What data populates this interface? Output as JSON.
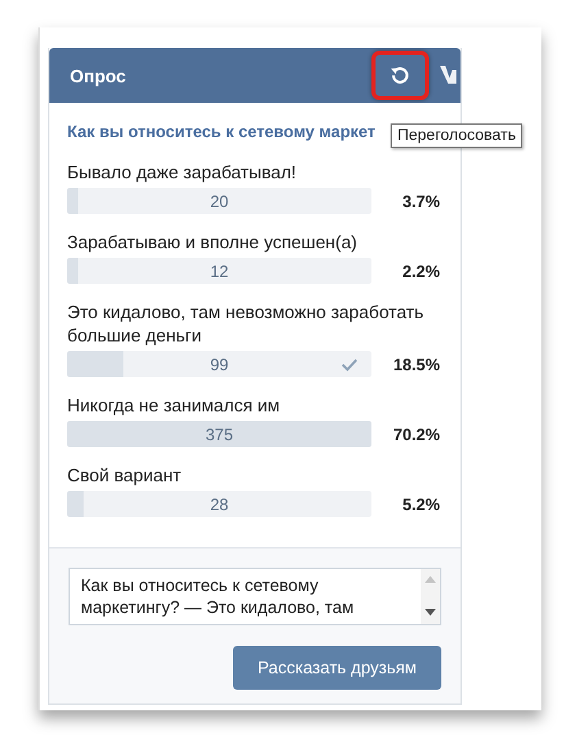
{
  "header": {
    "title": "Опрос"
  },
  "tooltip": {
    "text": "Переголосовать"
  },
  "poll": {
    "question": "Как вы относитесь к сетевому маркет",
    "options": [
      {
        "label": "Бывало даже зарабатывал!",
        "votes": "20",
        "percent": "3.7%",
        "level": 0.037,
        "voted": false
      },
      {
        "label": "Зарабатываю и вполне успешен(а)",
        "votes": "12",
        "percent": "2.2%",
        "level": 0.022,
        "voted": false
      },
      {
        "label": "Это кидалово, там невозможно заработать большие деньги",
        "votes": "99",
        "percent": "18.5%",
        "level": 0.185,
        "voted": true
      },
      {
        "label": "Никогда не занимался им",
        "votes": "375",
        "percent": "70.2%",
        "level": 1,
        "voted": false
      },
      {
        "label": "Свой вариант",
        "votes": "28",
        "percent": "5.2%",
        "level": 0.052,
        "voted": false
      }
    ]
  },
  "share": {
    "text": "Как вы относитесь к сетевому маркетингу? — Это кидалово, там",
    "button": "Рассказать друзьям"
  }
}
